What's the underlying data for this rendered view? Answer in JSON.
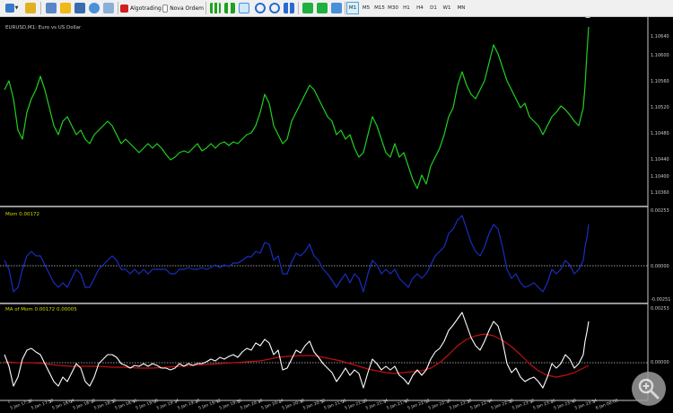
{
  "toolbar": {
    "algotrading_label": "Algotrading",
    "new_order_label": "Nova Ordem",
    "timeframes": [
      "M1",
      "M5",
      "M15",
      "M30",
      "H1",
      "H4",
      "D1",
      "W1",
      "MN"
    ],
    "active_timeframe": "M1"
  },
  "panes": {
    "main": {
      "header": "EURUSD,M1: Euro vs US Dollar",
      "price_labels": [
        "1.10640",
        "1.10600",
        "1.10560",
        "1.10520",
        "1.10480",
        "1.10440",
        "1.10400",
        "1.10360"
      ]
    },
    "mom": {
      "header": "Mom 0.00172",
      "axis_labels": [
        "0.00253",
        "0.00000",
        "-0.00251"
      ]
    },
    "ma": {
      "header": "MA of Mom 0.00172 0.00005",
      "axis_labels": [
        "0.00253",
        "0.00000"
      ]
    }
  },
  "time_labels": [
    "5 Jan 17:36",
    "5 Jan 17:50",
    "5 Jan 18:04",
    "5 Jan 18:18",
    "5 Jan 18:32",
    "5 Jan 18:46",
    "5 Jan 19:00",
    "5 Jan 19:14",
    "5 Jan 19:28",
    "5 Jan 19:42",
    "5 Jan 19:56",
    "5 Jan 20:10",
    "5 Jan 20:24",
    "5 Jan 20:38",
    "5 Jan 20:52",
    "5 Jan 21:06",
    "5 Jan 21:20",
    "5 Jan 21:34",
    "5 Jan 21:48",
    "5 Jan 22:02",
    "5 Jan 22:16",
    "5 Jan 22:30",
    "5 Jan 22:44",
    "5 Jan 22:58",
    "5 Jan 23:12",
    "5 Jan 23:26",
    "5 Jan 23:40",
    "5 Jan 23:54",
    "6 Jan 00:08"
  ],
  "colors": {
    "price": "#20d020",
    "momentum": "#1a2ec0",
    "ma_line": "#ffffff",
    "ma_signal": "#c01010",
    "pane_header": "#d4d400",
    "axis_text": "#c8c8c8",
    "separator": "#c8c8c8"
  },
  "icons": [
    "new-chart-icon",
    "profiles-icon",
    "folder-icon",
    "save-icon",
    "market-watch-icon",
    "navigator-icon",
    "terminal-icon",
    "tester-icon",
    "algotrading-icon",
    "new-order-icon",
    "bar-chart-icon",
    "candle-chart-icon",
    "line-chart-icon",
    "zoom-in-icon",
    "zoom-out-icon",
    "tile-icon",
    "autoscroll-icon",
    "shift-icon",
    "indicators-icon",
    "magnifier-icon"
  ]
}
